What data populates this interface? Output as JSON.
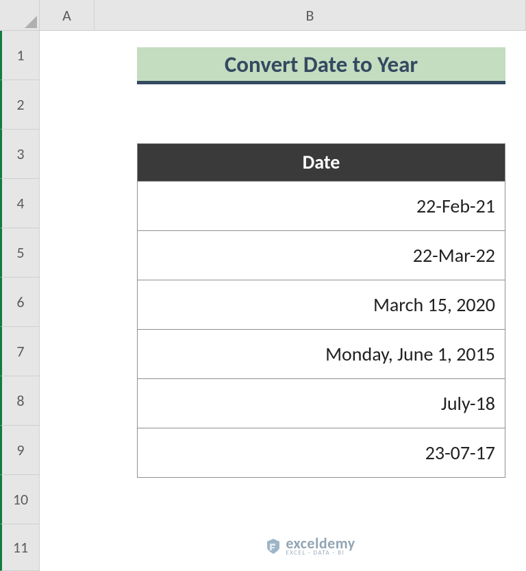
{
  "columns": [
    "A",
    "B"
  ],
  "rows": [
    "1",
    "2",
    "3",
    "4",
    "5",
    "6",
    "7",
    "8",
    "9",
    "10",
    "11"
  ],
  "title": "Convert Date to Year",
  "table": {
    "header": "Date",
    "values": [
      "22-Feb-21",
      "22-Mar-22",
      "March 15, 2020",
      "Monday, June 1, 2015",
      "July-18",
      "23-07-17"
    ]
  },
  "watermark": {
    "brand": "exceldemy",
    "tagline": "EXCEL · DATA · BI"
  },
  "colors": {
    "title_bg": "#c4dcc0",
    "title_underline": "#334a60",
    "header_bg": "#3a3a3a",
    "row_head_accent": "#107c41"
  }
}
